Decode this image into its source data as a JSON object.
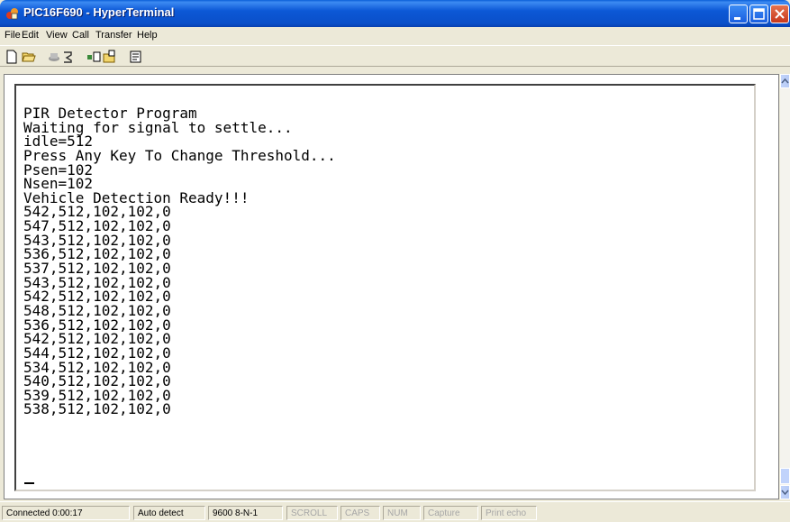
{
  "window": {
    "title": "PIC16F690 - HyperTerminal"
  },
  "menu": {
    "items": [
      "File",
      "Edit",
      "View",
      "Call",
      "Transfer",
      "Help"
    ]
  },
  "toolbar": {
    "icons": [
      "new-connection-icon",
      "open-icon",
      "disconnect-icon",
      "properties-dial-icon",
      "send-icon",
      "receive-icon",
      "properties-icon"
    ]
  },
  "terminal": {
    "lines": [
      "PIR Detector Program",
      "Waiting for signal to settle...",
      "idle=512",
      "Press Any Key To Change Threshold...",
      "Psen=102",
      "Nsen=102",
      "Vehicle Detection Ready!!!",
      "542,512,102,102,0",
      "547,512,102,102,0",
      "543,512,102,102,0",
      "536,512,102,102,0",
      "537,512,102,102,0",
      "543,512,102,102,0",
      "542,512,102,102,0",
      "548,512,102,102,0",
      "536,512,102,102,0",
      "542,512,102,102,0",
      "544,512,102,102,0",
      "534,512,102,102,0",
      "540,512,102,102,0",
      "539,512,102,102,0",
      "538,512,102,102,0"
    ]
  },
  "status": {
    "connected": "Connected 0:00:17",
    "detect": "Auto detect",
    "settings": "9600 8-N-1",
    "scroll": "SCROLL",
    "caps": "CAPS",
    "num": "NUM",
    "capture": "Capture",
    "print_echo": "Print echo"
  }
}
